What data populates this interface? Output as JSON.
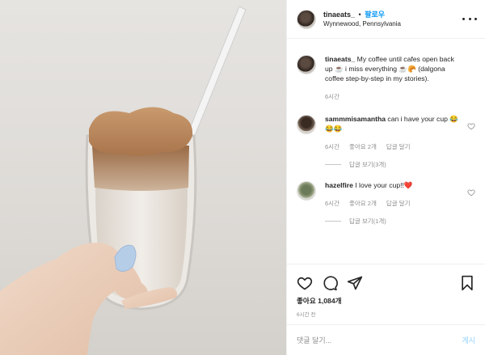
{
  "header": {
    "username": "tinaeats_",
    "separator": "•",
    "follow_label": "팔로우",
    "location": "Wynnewood, Pennsylvania"
  },
  "caption": {
    "username": "tinaeats_",
    "text": "My coffee until cafes open back up ☕ i miss everything ☕🥐 (dalgona coffee step-by-step in my stories).",
    "time": "6시간"
  },
  "comments": [
    {
      "username": "sammmisamantha",
      "text": "can i have your cup 😂😂😂",
      "time": "6시간",
      "likes": "좋아요 2개",
      "reply_label": "답글 달기",
      "view_replies": "답글 보기(3개)"
    },
    {
      "username": "hazelfire",
      "text": "I love your cup!!❤️",
      "time": "6시간",
      "likes": "좋아요 2개",
      "reply_label": "답글 달기",
      "view_replies": "답글 보기(1개)"
    }
  ],
  "likes": "좋아요 1,084개",
  "posted_ago": "6시간 전",
  "add_comment": {
    "placeholder": "댓글 달기...",
    "post_label": "게시"
  },
  "icons": {
    "heart": "heart-icon",
    "comment": "comment-icon",
    "share": "share-icon",
    "bookmark": "bookmark-icon",
    "more": "more-options-icon"
  },
  "colors": {
    "accent": "#0095f6",
    "muted": "#8e8e8e",
    "text": "#262626",
    "post_disabled": "#b2dffc"
  }
}
